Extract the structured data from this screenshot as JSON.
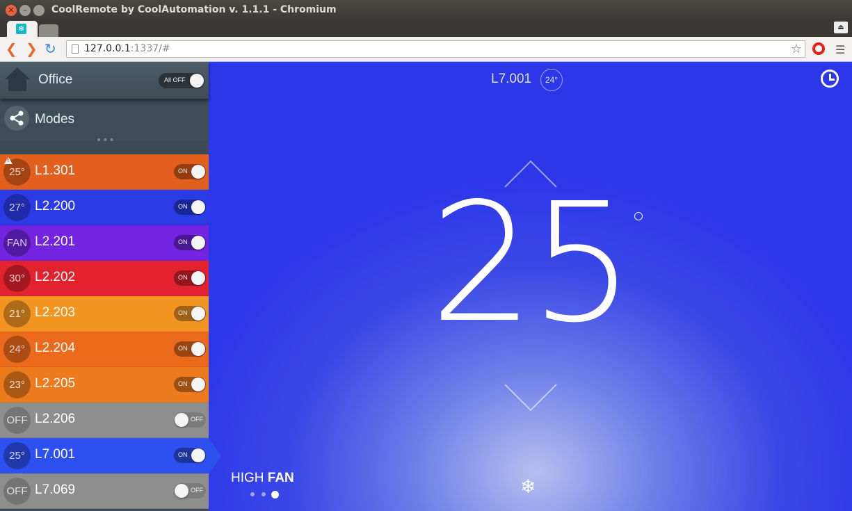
{
  "window": {
    "title": "CoolRemote by CoolAutomation v. 1.1.1 - Chromium"
  },
  "browser": {
    "url_host": "127.0.0.1",
    "url_rest": ":1337/#"
  },
  "sidebar": {
    "location": "Office",
    "all_off_label": "All OFF",
    "modes_label": "Modes",
    "units": [
      {
        "name": "L1.301",
        "temp": "25°",
        "state": "ON",
        "color": "#e35f1e",
        "warning": true
      },
      {
        "name": "L2.200",
        "temp": "27°",
        "state": "ON",
        "color": "#2a3be6",
        "warning": false
      },
      {
        "name": "L2.201",
        "temp": "FAN",
        "state": "ON",
        "color": "#7224e0",
        "warning": false
      },
      {
        "name": "L2.202",
        "temp": "30°",
        "state": "ON",
        "color": "#e2222e",
        "warning": false
      },
      {
        "name": "L2.203",
        "temp": "21°",
        "state": "ON",
        "color": "#f19420",
        "warning": false
      },
      {
        "name": "L2.204",
        "temp": "24°",
        "state": "ON",
        "color": "#ec6a1c",
        "warning": false
      },
      {
        "name": "L2.205",
        "temp": "23°",
        "state": "ON",
        "color": "#ee7a1e",
        "warning": false
      },
      {
        "name": "L2.206",
        "temp": "OFF",
        "state": "OFF",
        "color": "#8e8e8e",
        "warning": false
      },
      {
        "name": "L7.001",
        "temp": "25°",
        "state": "ON",
        "color": "#2d50f0",
        "warning": false
      },
      {
        "name": "L7.069",
        "temp": "OFF",
        "state": "OFF",
        "color": "#8e8e8e",
        "warning": false
      }
    ]
  },
  "main": {
    "unit_name": "L7.001",
    "room_temp": "24°",
    "setpoint": "25",
    "fan_speed": "HIGH",
    "fan_label": "FAN",
    "fan_page_index": 3,
    "mode_icon": "snowflake-icon",
    "accent": "#2d37ea"
  }
}
